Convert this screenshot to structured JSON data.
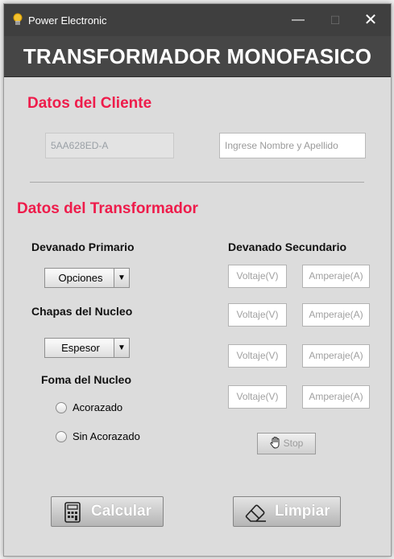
{
  "window": {
    "title": "Power Electronic",
    "controls": {
      "minimize": "—",
      "maximize": "☐",
      "close": "✕"
    }
  },
  "header": {
    "title": "TRANSFORMADOR MONOFASICO"
  },
  "cliente": {
    "section_title": "Datos del Cliente",
    "id_value": "5AA628ED-A",
    "name_placeholder": "Ingrese Nombre y Apellido"
  },
  "transformador": {
    "section_title": "Datos del Transformador",
    "devanado_primario": {
      "label": "Devanado Primario",
      "combo_value": "Opciones"
    },
    "chapas": {
      "label": "Chapas del Nucleo",
      "combo_value": "Espesor"
    },
    "forma": {
      "label": "Foma del Nucleo",
      "options": [
        "Acorazado",
        "Sin Acorazado"
      ]
    },
    "devanado_secundario": {
      "label": "Devanado Secundario",
      "rows": [
        {
          "voltaje": "Voltaje(V)",
          "amperaje": "Amperaje(A)"
        },
        {
          "voltaje": "Voltaje(V)",
          "amperaje": "Amperaje(A)"
        },
        {
          "voltaje": "Voltaje(V)",
          "amperaje": "Amperaje(A)"
        },
        {
          "voltaje": "Voltaje(V)",
          "amperaje": "Amperaje(A)"
        }
      ],
      "stop_label": "Stop"
    }
  },
  "actions": {
    "calcular": "Calcular",
    "limpiar": "Limpiar"
  },
  "icons": {
    "app": "lightbulb-icon",
    "stop": "hand-icon",
    "calcular": "calculator-icon",
    "limpiar": "eraser-icon"
  },
  "colors": {
    "accent": "#ee1c4b",
    "header": "#464646",
    "titlebar": "#3f3f3f"
  }
}
